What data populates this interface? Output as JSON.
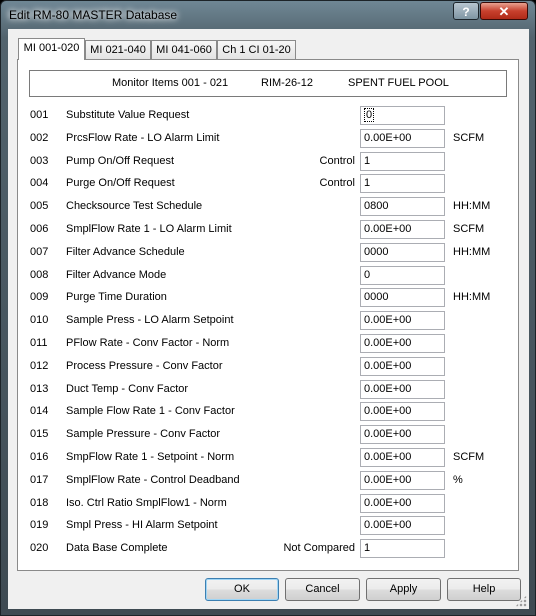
{
  "window": {
    "title": "Edit RM-80 MASTER Database",
    "help_label": "?",
    "close_label": "✕"
  },
  "tabs": [
    {
      "label": "MI 001-020",
      "active": true
    },
    {
      "label": "MI 021-040",
      "active": false
    },
    {
      "label": "MI 041-060",
      "active": false
    },
    {
      "label": "Ch 1 CI 01-20",
      "active": false
    }
  ],
  "header": {
    "items": "Monitor Items 001 - 021",
    "monitor": "RIM-26-12",
    "location": "SPENT FUEL POOL"
  },
  "rows": [
    {
      "num": "001",
      "label": "Substitute Value Request",
      "control": "",
      "value": "0",
      "unit": ""
    },
    {
      "num": "002",
      "label": "PrcsFlow Rate - LO Alarm Limit",
      "control": "",
      "value": "0.00E+00",
      "unit": "SCFM"
    },
    {
      "num": "003",
      "label": "Pump On/Off Request",
      "control": "Control",
      "value": "1",
      "unit": ""
    },
    {
      "num": "004",
      "label": "Purge On/Off Request",
      "control": "Control",
      "value": "1",
      "unit": ""
    },
    {
      "num": "005",
      "label": "Checksource Test Schedule",
      "control": "",
      "value": "0800",
      "unit": "HH:MM"
    },
    {
      "num": "006",
      "label": "SmplFlow Rate 1 - LO Alarm Limit",
      "control": "",
      "value": "0.00E+00",
      "unit": "SCFM"
    },
    {
      "num": "007",
      "label": "Filter Advance Schedule",
      "control": "",
      "value": "0000",
      "unit": "HH:MM"
    },
    {
      "num": "008",
      "label": "Filter Advance Mode",
      "control": "",
      "value": "0",
      "unit": ""
    },
    {
      "num": "009",
      "label": "Purge Time Duration",
      "control": "",
      "value": "0000",
      "unit": "HH:MM"
    },
    {
      "num": "010",
      "label": "Sample Press - LO Alarm Setpoint",
      "control": "",
      "value": "0.00E+00",
      "unit": ""
    },
    {
      "num": "011",
      "label": "PFlow Rate - Conv Factor - Norm",
      "control": "",
      "value": "0.00E+00",
      "unit": ""
    },
    {
      "num": "012",
      "label": "Process Pressure - Conv Factor",
      "control": "",
      "value": "0.00E+00",
      "unit": ""
    },
    {
      "num": "013",
      "label": "Duct Temp - Conv Factor",
      "control": "",
      "value": "0.00E+00",
      "unit": ""
    },
    {
      "num": "014",
      "label": "Sample Flow Rate 1 - Conv Factor",
      "control": "",
      "value": "0.00E+00",
      "unit": ""
    },
    {
      "num": "015",
      "label": "Sample Pressure - Conv Factor",
      "control": "",
      "value": "0.00E+00",
      "unit": ""
    },
    {
      "num": "016",
      "label": "SmpFlow Rate 1 - Setpoint - Norm",
      "control": "",
      "value": "0.00E+00",
      "unit": "SCFM"
    },
    {
      "num": "017",
      "label": "SmplFlow Rate - Control Deadband",
      "control": "",
      "value": "0.00E+00",
      "unit": "%"
    },
    {
      "num": "018",
      "label": "Iso. Ctrl Ratio SmplFlow1 - Norm",
      "control": "",
      "value": "0.00E+00",
      "unit": ""
    },
    {
      "num": "019",
      "label": "Smpl Press - HI Alarm Setpoint",
      "control": "",
      "value": "0.00E+00",
      "unit": ""
    },
    {
      "num": "020",
      "label": "Data Base Complete",
      "control": "Not Compared",
      "value": "1",
      "unit": ""
    }
  ],
  "buttons": {
    "ok": "OK",
    "cancel": "Cancel",
    "apply": "Apply",
    "help": "Help"
  }
}
